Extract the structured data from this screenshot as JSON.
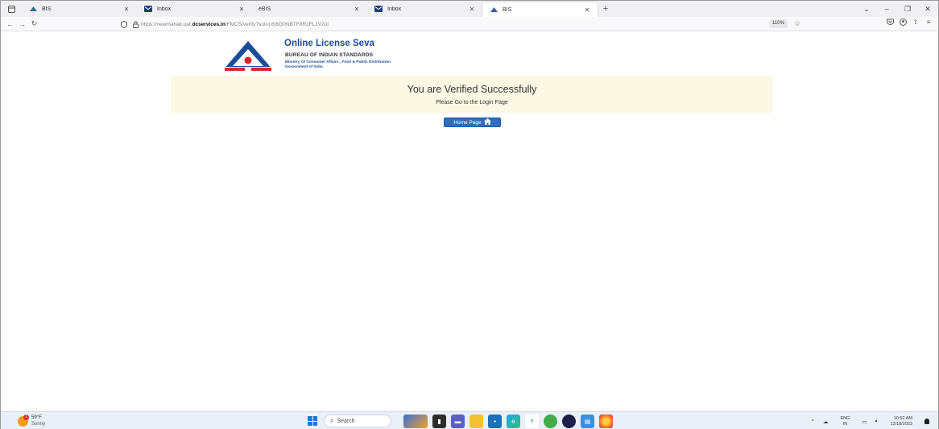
{
  "browser": {
    "tabs": [
      {
        "title": "BIS",
        "icon": "bis-logo-icon",
        "active": false
      },
      {
        "title": "Inbox",
        "icon": "mail-icon",
        "active": false
      },
      {
        "title": "eBIS",
        "icon": "none",
        "active": false
      },
      {
        "title": "Inbox",
        "icon": "mail-icon",
        "active": false
      },
      {
        "title": "BIS",
        "icon": "bis-logo-icon",
        "active": true
      }
    ],
    "url_prefix": "https://newmanak.uat.",
    "url_domain": "dcservices.in",
    "url_suffix": "/FMCS/verify?sut=L6t6G0NBTF8R2FL1V2ul",
    "zoom": "110%"
  },
  "header": {
    "title": "Online License Seva",
    "org": "BUREAU OF INDIAN STANDARDS",
    "ministry": "Ministry Of Consumer Affairs , Food & Public Distribution",
    "government": "Government of India"
  },
  "banner": {
    "title": "You are Verified Successfully",
    "subtitle": "Please Go to the Login Page"
  },
  "home_button": {
    "label": "Home Page"
  },
  "taskbar": {
    "weather_temp": "59°F",
    "weather_desc": "Sunny",
    "weather_badge": "1",
    "search_placeholder": "Search",
    "lang_top": "ENG",
    "lang_bottom": "IN",
    "time": "10:52 AM",
    "date": "12/18/2023"
  },
  "colors": {
    "brand_blue": "#1b4c9a",
    "banner_bg": "#fcf8e3",
    "button_blue": "#2f6dbb"
  }
}
